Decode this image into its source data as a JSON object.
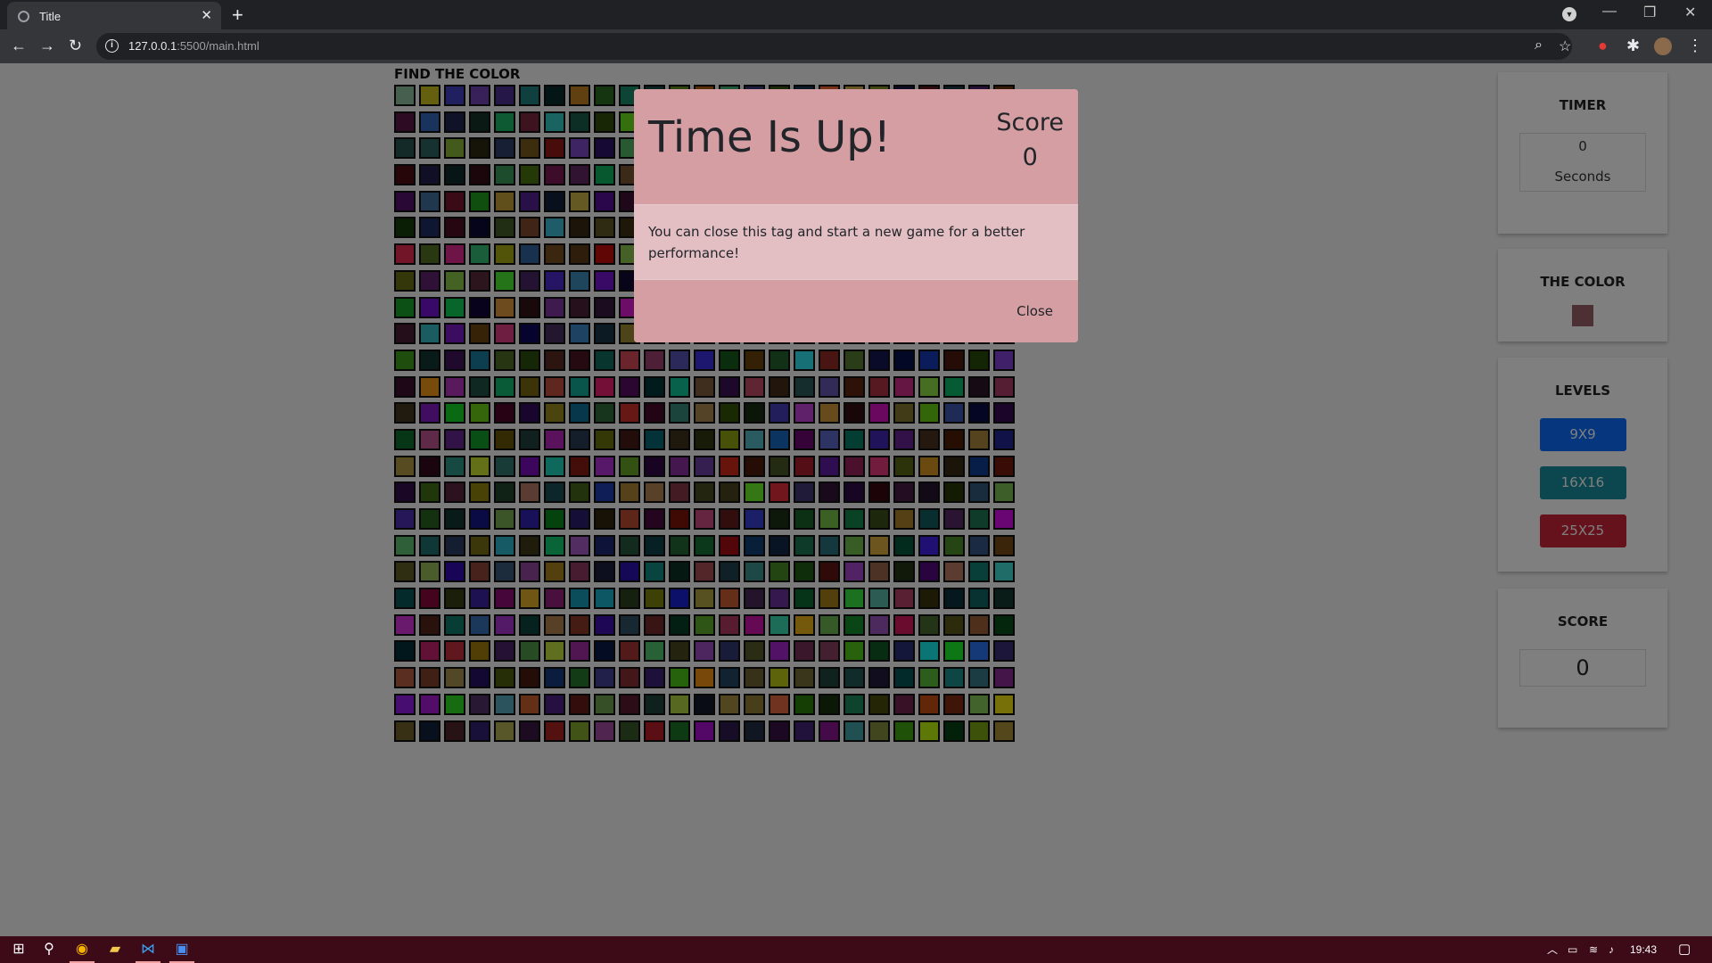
{
  "browser": {
    "tab_title": "Title",
    "url_host": "127.0.0.1",
    "url_rest": ":5500/main.html"
  },
  "page": {
    "heading": "FIND THE COLOR",
    "grid_size": 25,
    "grid_colors_sample": [
      "#8fbf9f",
      "#c8c020",
      "#4040c0",
      "#7040b0",
      "#4a2e90",
      "#1f7f7f",
      "#072a2a",
      "#c08020",
      "#2a6a20",
      "#1a8a6a"
    ]
  },
  "sidebar": {
    "timer": {
      "title": "TIMER",
      "value": "0",
      "unit": "Seconds"
    },
    "the_color": {
      "title": "THE COLOR",
      "color": "#9a6068"
    },
    "levels": {
      "title": "LEVELS",
      "buttons": [
        {
          "label": "9X9",
          "color": "#0d6efd"
        },
        {
          "label": "16X16",
          "color": "#198e9e"
        },
        {
          "label": "25X25",
          "color": "#cc2538"
        }
      ]
    },
    "score": {
      "title": "SCORE",
      "value": "0"
    }
  },
  "modal": {
    "title": "Time Is Up!",
    "score_label": "Score",
    "score_value": "0",
    "message": "You can close this tag and start a new game for a better performance!",
    "close_label": "Close"
  },
  "taskbar": {
    "time": "19:43"
  }
}
